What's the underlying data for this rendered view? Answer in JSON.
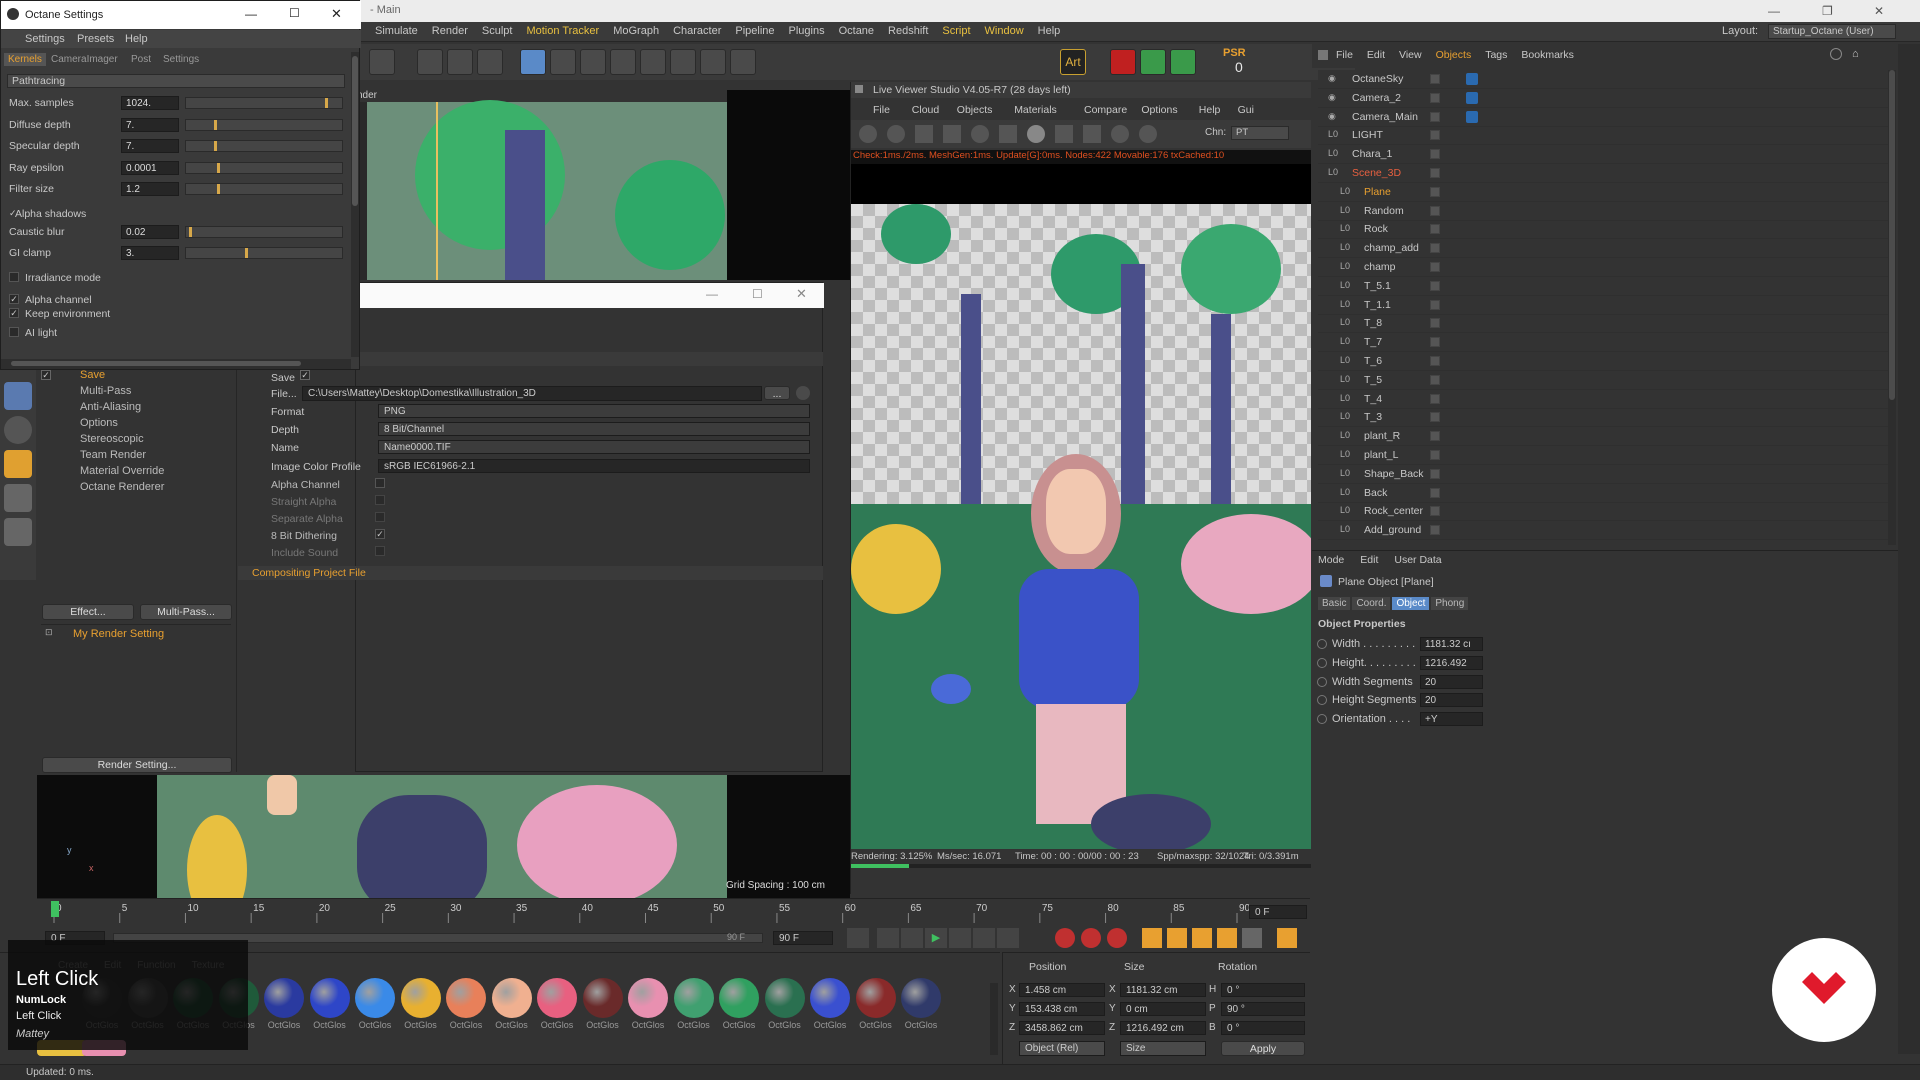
{
  "app": {
    "title": "- Main",
    "layout_label": "Layout:",
    "layout_value": "Startup_Octane (User)"
  },
  "menu": [
    "Simulate",
    "Render",
    "Sculpt",
    "Motion Tracker",
    "MoGraph",
    "Character",
    "Pipeline",
    "Plugins",
    "Octane",
    "Redshift",
    "Script",
    "Window",
    "Help"
  ],
  "octane_settings": {
    "title": "Octane Settings",
    "menu": [
      "Settings",
      "Presets",
      "Help"
    ],
    "tabs": [
      "Kernels",
      "CameraImager",
      "Post",
      "Settings"
    ],
    "mode": "Pathtracing",
    "params": [
      {
        "label": "Max. samples",
        "value": "1024.",
        "fill": 0.9
      },
      {
        "label": "Diffuse depth",
        "value": "7.",
        "fill": 0.18
      },
      {
        "label": "Specular depth",
        "value": "7.",
        "fill": 0.18
      },
      {
        "label": "Ray epsilon",
        "value": "0.0001",
        "fill": 0.2
      },
      {
        "label": "Filter size",
        "value": "1.2",
        "fill": 0.2
      }
    ],
    "alpha_shadows": "Alpha shadows",
    "params2": [
      {
        "label": "Caustic blur",
        "value": "0.02",
        "fill": 0.02
      },
      {
        "label": "GI clamp",
        "value": "3.",
        "fill": 0.38
      }
    ],
    "checks": [
      "Irradiance mode",
      "Alpha channel",
      "Keep environment",
      "AI light"
    ]
  },
  "render_settings": {
    "items": [
      "Save",
      "Multi-Pass",
      "Anti-Aliasing",
      "Options",
      "Stereoscopic",
      "Team Render",
      "Material Override",
      "Octane Renderer"
    ],
    "effect_btn": "Effect...",
    "multipass_btn": "Multi-Pass...",
    "preset": "My Render Setting",
    "render_setting_btn": "Render Setting...",
    "save_label": "Save",
    "file_label": "File...",
    "file_path": "C:\\Users\\Mattey\\Desktop\\Domestika\\Illustration_3D",
    "format_label": "Format",
    "format_value": "PNG",
    "depth_label": "Depth",
    "depth_value": "8 Bit/Channel",
    "name_label": "Name",
    "name_value": "Name0000.TIF",
    "icp_label": "Image Color Profile",
    "icp_value": "sRGB IEC61966-2.1",
    "alpha_label": "Alpha Channel",
    "straight_label": "Straight Alpha",
    "separate_label": "Separate Alpha",
    "dither_label": "8 Bit Dithering",
    "include_label": "Include Sound",
    "compositing": "Compositing Project File",
    "browse": "..."
  },
  "viewer": {
    "title": "Live Viewer Studio V4.05-R7 (28 days left)",
    "menu": [
      "File",
      "Cloud",
      "Objects",
      "Materials",
      "Compare",
      "Options",
      "Help",
      "Gui"
    ],
    "chn_label": "Chn:",
    "chn_value": "PT",
    "status": "Check:1ms./2ms. MeshGen:1ms. Update[G]:0ms. Nodes:422 Movable:176 txCached:10",
    "footer": [
      "Rendering: 3.125%",
      "Ms/sec: 16.071",
      "Time: 00 : 00 : 00/00 : 00 : 23",
      "Spp/maxspp: 32/1024",
      "Tri: 0/3.391m"
    ],
    "progress": 0.03125
  },
  "viewport_label": "nder",
  "grid_spacing": "Grid Spacing : 100 cm",
  "objects": {
    "menu": [
      "File",
      "Edit",
      "View",
      "Objects",
      "Tags",
      "Bookmarks"
    ],
    "rows": [
      "OctaneSky",
      "Camera_2",
      "Camera_Main",
      "LIGHT",
      "Chara_1",
      "Scene_3D",
      "Plane",
      "Random",
      "Rock",
      "champ_add",
      "champ",
      "T_5.1",
      "T_1.1",
      "T_8",
      "T_7",
      "T_6",
      "T_5",
      "T_4",
      "T_3",
      "plant_R",
      "plant_L",
      "Shape_Back",
      "Back",
      "Rock_center",
      "Add_ground"
    ]
  },
  "attributes": {
    "menu": [
      "Mode",
      "Edit",
      "User Data"
    ],
    "object_title": "Plane Object [Plane]",
    "tabs": [
      "Basic",
      "Coord.",
      "Object",
      "Phong"
    ],
    "section": "Object Properties",
    "props": [
      {
        "label": "Width . . . . . . . . .",
        "value": "1181.32 cı"
      },
      {
        "label": "Height. . . . . . . . .",
        "value": "1216.492"
      },
      {
        "label": "Width Segments",
        "value": "20"
      },
      {
        "label": "Height Segments",
        "value": "20"
      },
      {
        "label": "Orientation . . . .",
        "value": "+Y"
      }
    ]
  },
  "timeline": {
    "ticks": [
      "0",
      "5",
      "10",
      "15",
      "20",
      "25",
      "30",
      "35",
      "40",
      "45",
      "50",
      "55",
      "60",
      "65",
      "70",
      "75",
      "80",
      "85",
      "90"
    ],
    "frame_left": "0 F",
    "frame_right": "90 F",
    "end": "90 F",
    "cur": "0 F",
    "psr": "PSR",
    "psr_value": "0"
  },
  "coords": {
    "headers": [
      "Position",
      "Size",
      "Rotation"
    ],
    "rows": [
      {
        "axis": "X",
        "pos": "1.458 cm",
        "size": "1181.32 cm",
        "rot_axis": "H",
        "rot": "0 °"
      },
      {
        "axis": "Y",
        "pos": "153.438 cm",
        "size": "0 cm",
        "rot_axis": "P",
        "rot": "90 °"
      },
      {
        "axis": "Z",
        "pos": "3458.862 cm",
        "size": "1216.492 cm",
        "rot_axis": "B",
        "rot": "0 °"
      }
    ],
    "mode": "Object (Rel)",
    "size_mode": "Size",
    "apply": "Apply"
  },
  "materials": {
    "menu": [
      "Create",
      "Edit",
      "Function",
      "Texture"
    ],
    "label": "OctGlos",
    "colors": [
      "#3a3a3a",
      "#4a4a4a",
      "#1f5a3a",
      "#1f5a3a",
      "#2a3aa0",
      "#2e46c8",
      "#3a8ae8",
      "#e8b030",
      "#e8805a",
      "#f0b090",
      "#e86080",
      "#6a2a2a",
      "#e890b0",
      "#40a070",
      "#30a060",
      "#2a7050",
      "#3a50d0",
      "#8a2a2a",
      "#303a6a"
    ]
  },
  "keycast": {
    "title": "Left Click",
    "l1": "NumLock",
    "l2": "Left Click",
    "l3": "Mattey"
  },
  "statusbar": "Updated: 0 ms."
}
